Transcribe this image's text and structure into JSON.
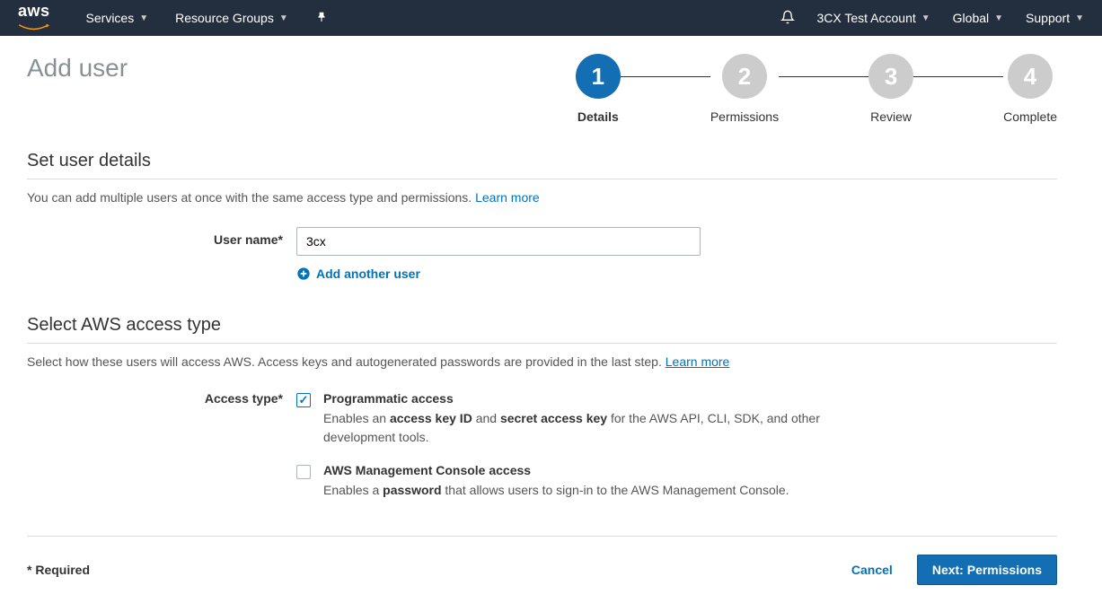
{
  "header": {
    "services": "Services",
    "resourceGroups": "Resource Groups",
    "account": "3CX Test Account",
    "region": "Global",
    "support": "Support"
  },
  "page": {
    "title": "Add user"
  },
  "wizard": {
    "steps": [
      {
        "num": "1",
        "label": "Details"
      },
      {
        "num": "2",
        "label": "Permissions"
      },
      {
        "num": "3",
        "label": "Review"
      },
      {
        "num": "4",
        "label": "Complete"
      }
    ]
  },
  "section1": {
    "title": "Set user details",
    "help": "You can add multiple users at once with the same access type and permissions. ",
    "learnMore": "Learn more",
    "userNameLabel": "User name*",
    "userNameValue": "3cx",
    "addAnother": "Add another user"
  },
  "section2": {
    "title": "Select AWS access type",
    "help": "Select how these users will access AWS. Access keys and autogenerated passwords are provided in the last step. ",
    "learnMore": "Learn more",
    "accessTypeLabel": "Access type*",
    "option1": {
      "title": "Programmatic access",
      "descPre": "Enables an ",
      "bold1": "access key ID",
      "descMid": " and ",
      "bold2": "secret access key",
      "descPost": " for the AWS API, CLI, SDK, and other development tools."
    },
    "option2": {
      "title": "AWS Management Console access",
      "descPre": "Enables a ",
      "bold1": "password",
      "descPost": " that allows users to sign-in to the AWS Management Console."
    }
  },
  "footer": {
    "required": "* Required",
    "cancel": "Cancel",
    "next": "Next: Permissions"
  }
}
